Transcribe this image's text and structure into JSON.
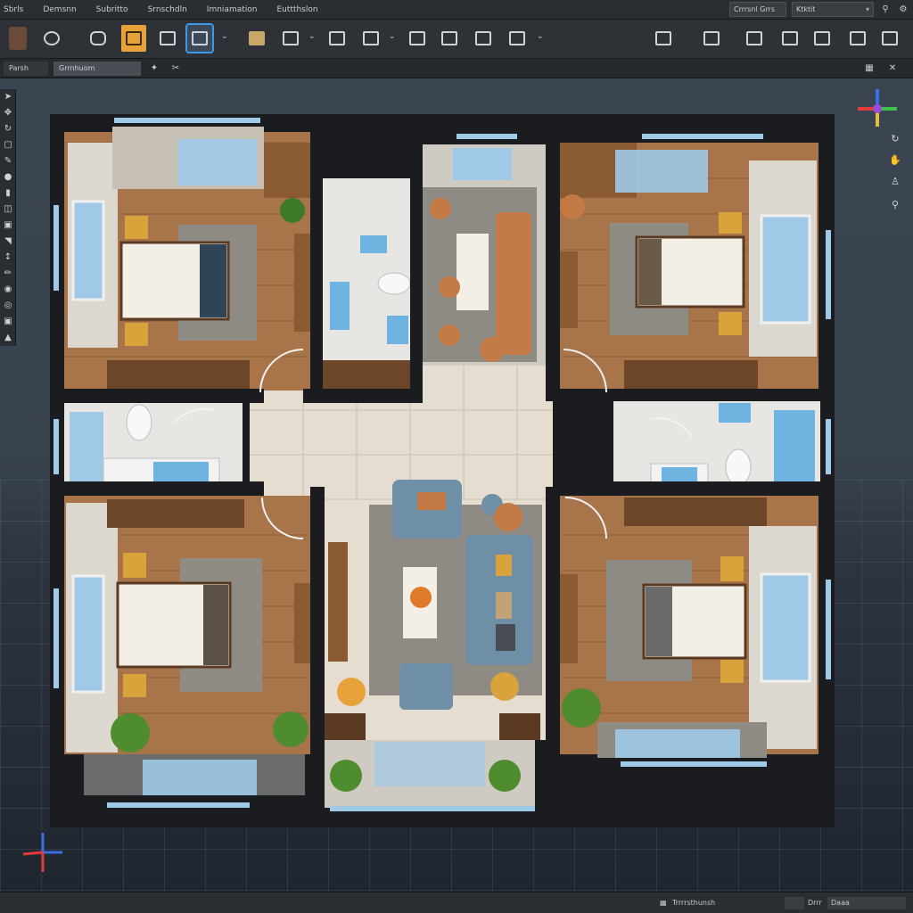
{
  "menu": {
    "items": [
      "Sbrls",
      "Demsnn",
      "Subritto",
      "Srnschdln",
      "Imniamation",
      "Euttthslon"
    ],
    "search_placeholder": "Crrrsnl Grrs",
    "view_select": "Ktktit"
  },
  "toolbar": {
    "tools": [
      "user-avatar-icon",
      "globe-icon",
      "shapes-icon",
      "move-tool-icon",
      "grid-icon",
      "frame-icon",
      "folder-icon",
      "columns-icon",
      "monitor-icon",
      "layers-icon",
      "image-icon",
      "wrench-icon",
      "cursor-icon",
      "camera-icon",
      "lamp-icon",
      "dimension-icon",
      "branch-icon",
      "frame-select-icon",
      "house-icon",
      "sofa-icon"
    ]
  },
  "subbar": {
    "tab1": "Parsh",
    "tab2": "Grrnhuom"
  },
  "status": {
    "left_label": "Trrrrsthunsh",
    "mid_label": "Drrr",
    "right_label": "Daaa"
  },
  "colors": {
    "wood": "#a8744a",
    "wall": "#1b1c1f",
    "tile": "#e4ddd0",
    "window": "#9fc9e6",
    "rug": "#8e8a84",
    "sofa_blue": "#6f8fa6",
    "sofa_orange": "#c37a45",
    "accent_orange": "#e7a23a",
    "accent_blue": "#3d9ae8"
  },
  "rooms": [
    "bedroom-top-left",
    "bedroom-top-right",
    "bedroom-bottom-left",
    "bedroom-bottom-right",
    "bathroom-top-center",
    "bathroom-left",
    "bathroom-right",
    "living-room-top",
    "living-room-center",
    "hallway",
    "entry-patio"
  ]
}
